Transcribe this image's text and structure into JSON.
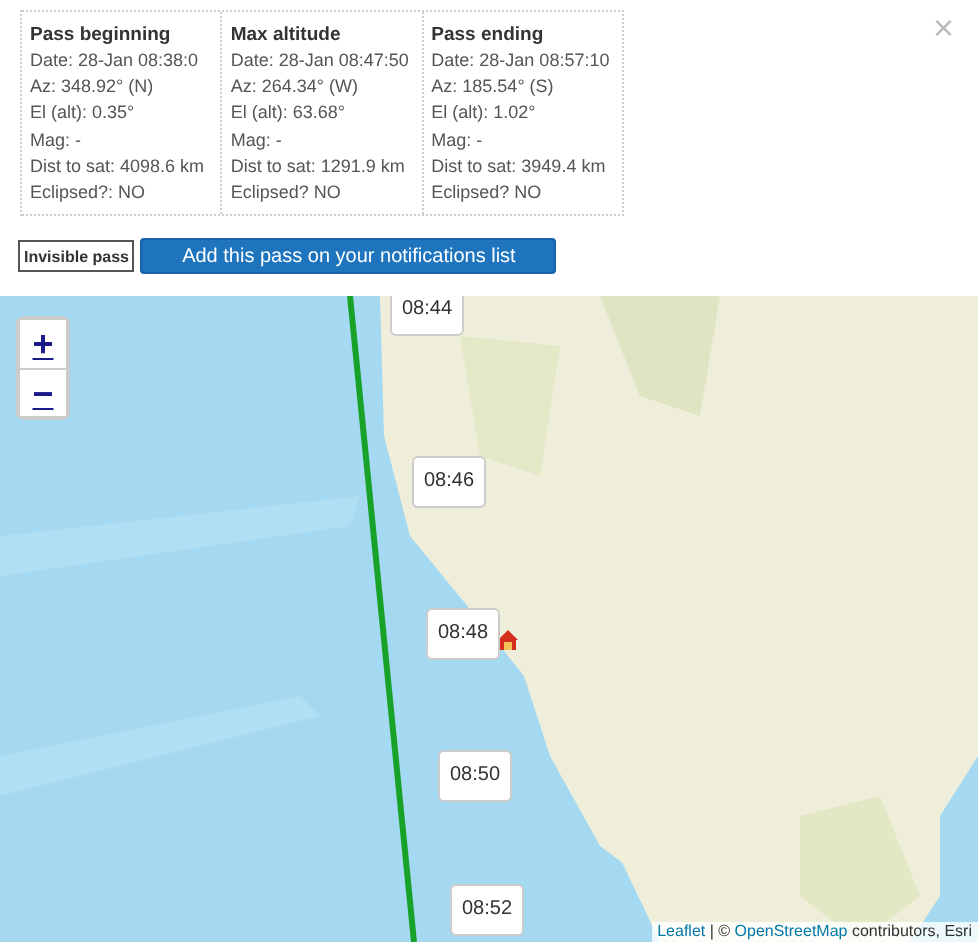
{
  "pass_table": [
    {
      "heading": "Pass beginning",
      "lines": [
        "Date: 28-Jan 08:38:0",
        "Az: 348.92° (N)",
        "El (alt): 0.35°",
        "Mag: -",
        "Dist to sat: 4098.6 km",
        "Eclipsed?: NO"
      ]
    },
    {
      "heading": "Max altitude",
      "lines": [
        "Date: 28-Jan 08:47:50",
        "Az: 264.34° (W)",
        "El (alt): 63.68°",
        "Mag: -",
        "Dist to sat: 1291.9 km",
        "Eclipsed? NO"
      ]
    },
    {
      "heading": "Pass ending",
      "lines": [
        "Date: 28-Jan 08:57:10",
        "Az: 185.54° (S)",
        "El (alt): 1.02°",
        "Mag: -",
        "Dist to sat: 3949.4 km",
        "Eclipsed? NO"
      ]
    }
  ],
  "close": "×",
  "buttons": [
    {
      "kind": "tag",
      "label": "Invisible pass"
    },
    {
      "kind": "primary",
      "label": "Add this pass on your notifications list"
    }
  ],
  "map": {
    "zoom": [
      "+",
      "−"
    ],
    "time_labels": [
      "08:44",
      "08:46",
      "08:48",
      "08:50",
      "08:52"
    ],
    "attribution": [
      {
        "kind": "link",
        "text": "Leaflet"
      },
      {
        "kind": "text",
        "text": " | © "
      },
      {
        "kind": "link",
        "text": "OpenStreetMap"
      },
      {
        "kind": "text",
        "text": " contributors, Esri"
      }
    ]
  }
}
